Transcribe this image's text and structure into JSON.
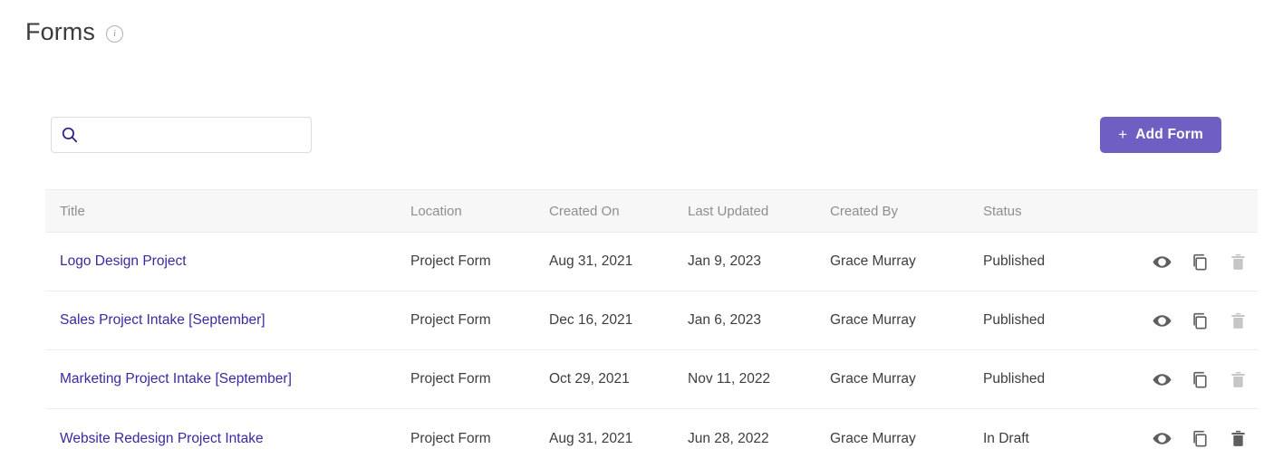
{
  "header": {
    "title": "Forms",
    "info_icon": "info-circle-icon",
    "info_glyph": "i"
  },
  "toolbar": {
    "search": {
      "icon": "search-icon",
      "value": "",
      "placeholder": ""
    },
    "add_button": {
      "label": "Add Form",
      "plus_glyph": "+",
      "color": "#6f5fc2"
    }
  },
  "table": {
    "columns": [
      "Title",
      "Location",
      "Created On",
      "Last Updated",
      "Created By",
      "Status",
      ""
    ],
    "rows": [
      {
        "title": "Logo Design Project",
        "location": "Project Form",
        "created_on": "Aug 31, 2021",
        "last_updated": "Jan 9, 2023",
        "created_by": "Grace Murray",
        "status": "Published",
        "delete_enabled": false
      },
      {
        "title": "Sales Project Intake [September]",
        "location": "Project Form",
        "created_on": "Dec 16, 2021",
        "last_updated": "Jan 6, 2023",
        "created_by": "Grace Murray",
        "status": "Published",
        "delete_enabled": false
      },
      {
        "title": "Marketing Project Intake [September]",
        "location": "Project Form",
        "created_on": "Oct 29, 2021",
        "last_updated": "Nov 11, 2022",
        "created_by": "Grace Murray",
        "status": "Published",
        "delete_enabled": false
      },
      {
        "title": "Website Redesign Project Intake",
        "location": "Project Form",
        "created_on": "Aug 31, 2021",
        "last_updated": "Jun 28, 2022",
        "created_by": "Grace Murray",
        "status": "In Draft",
        "delete_enabled": true
      }
    ],
    "actions": {
      "view": "eye-icon",
      "duplicate": "copy-icon",
      "delete": "trash-icon"
    }
  },
  "colors": {
    "accent": "#6f5fc2",
    "link": "#3c28a0",
    "header_bg": "#f7f7f7",
    "border": "#ededed"
  }
}
